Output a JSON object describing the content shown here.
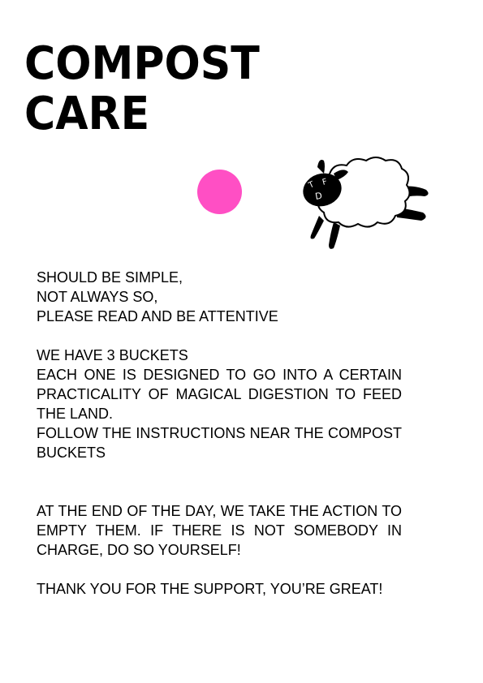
{
  "title": {
    "line1": "COMPOST",
    "line2": "CARE"
  },
  "logo": {
    "mark": "TFD"
  },
  "body": {
    "p1_l1": "SHOULD BE SIMPLE,",
    "p1_l2": "NOT ALWAYS SO,",
    "p1_l3": "PLEASE READ AND BE ATTENTIVE",
    "p2_l1": "WE HAVE 3 BUCKETS",
    "p2_l2": "EACH ONE IS DESIGNED TO GO INTO A CERTAIN PRACTICALITY OF MAGICAL DIGESTION TO FEED THE LAND.",
    "p2_l3": "FOLLOW THE INSTRUCTIONS NEAR THE COMPOST BUCKETS",
    "p3": "AT THE END OF THE DAY, WE TAKE THE ACTION TO EMPTY THEM. IF THERE IS NOT SOMEBODY IN CHARGE, DO SO YOURSELF!",
    "p4": "THANK YOU FOR THE SUPPORT, YOU’RE GREAT!"
  },
  "colors": {
    "accent_dot": "#ff4fc4",
    "text": "#000000",
    "background": "#ffffff"
  }
}
